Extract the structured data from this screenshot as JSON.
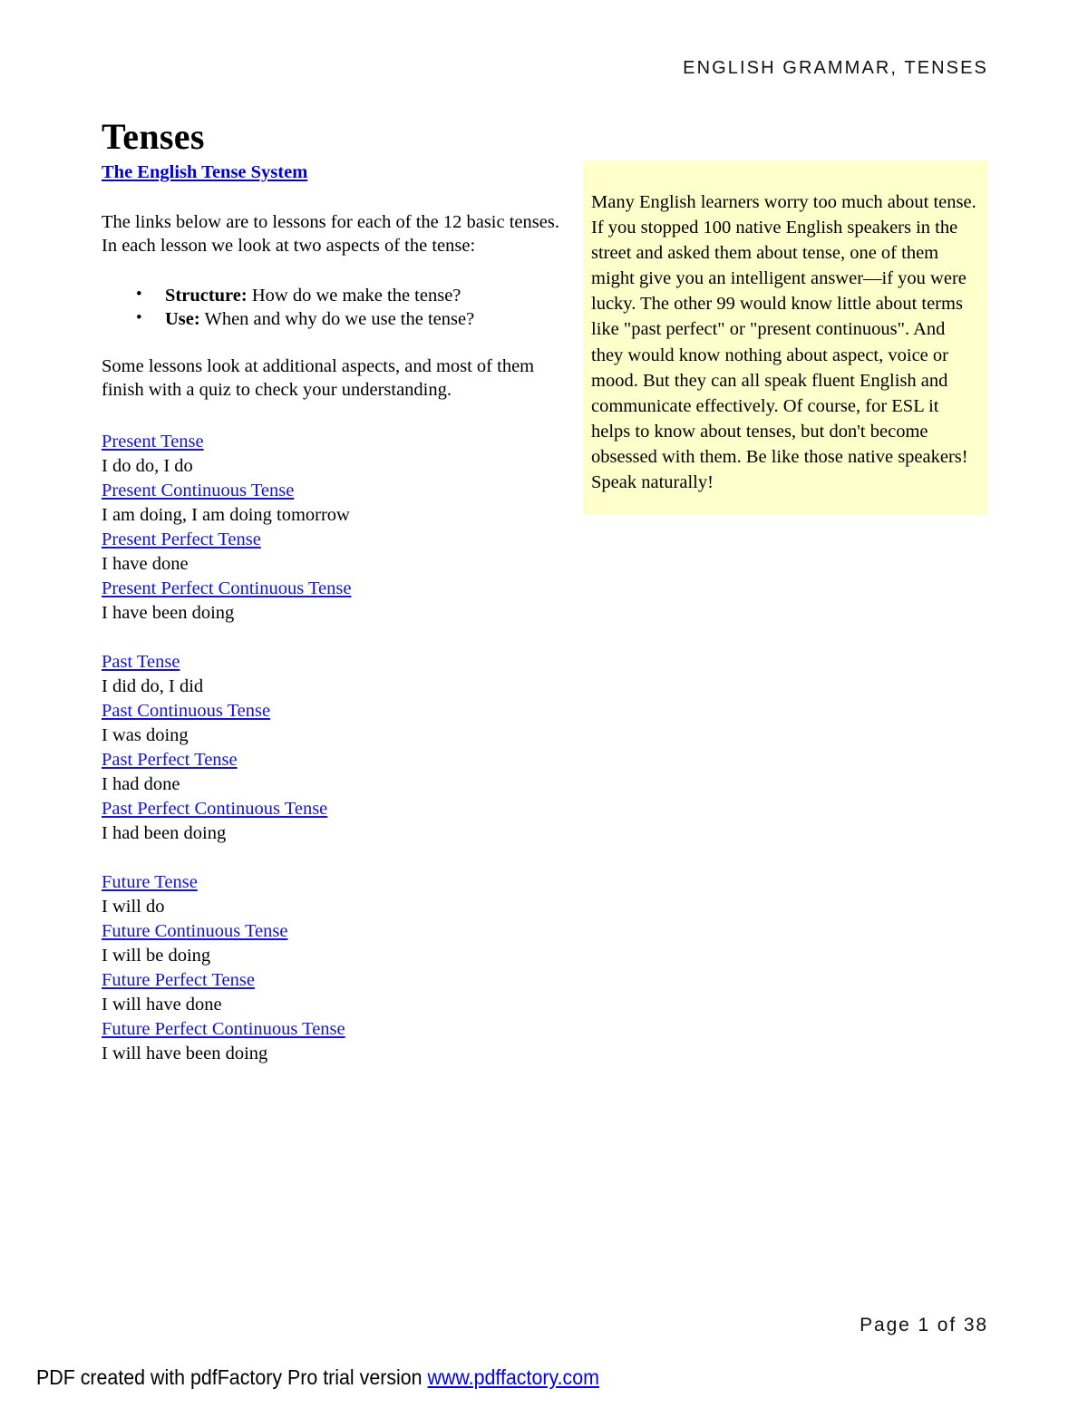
{
  "header": {
    "running_title": "ENGLISH GRAMMAR, TENSES"
  },
  "title": "Tenses",
  "left_column": {
    "section_link": "The English Tense System",
    "intro_paragraph": "The links below are to lessons for each of the 12 basic tenses. In each lesson we look at two aspects of the tense:",
    "aspects": [
      {
        "term": "Structure:",
        "description": " How do we make the tense?"
      },
      {
        "term": "Use:",
        "description": " When and why do we use the tense?"
      }
    ],
    "extra_paragraph": "Some lessons look at additional aspects, and most of them finish with a quiz to check your understanding.",
    "tense_groups": [
      {
        "name": "present",
        "entries": [
          {
            "link": "Present Tense",
            "example": "I do do, I do"
          },
          {
            "link": "Present Continuous Tense",
            "example": "I am doing, I am doing tomorrow"
          },
          {
            "link": "Present Perfect Tense",
            "example": "I have done"
          },
          {
            "link": "Present Perfect Continuous Tense",
            "example": "I have been doing"
          }
        ]
      },
      {
        "name": "past",
        "entries": [
          {
            "link": "Past Tense",
            "example": "I did do, I did"
          },
          {
            "link": "Past Continuous Tense",
            "example": "I was doing"
          },
          {
            "link": "Past Perfect Tense",
            "example": "I had done"
          },
          {
            "link": "Past Perfect Continuous Tense",
            "example": "I had been doing"
          }
        ]
      },
      {
        "name": "future",
        "entries": [
          {
            "link": "Future Tense",
            "example": "I will do"
          },
          {
            "link": "Future Continuous Tense",
            "example": "I will be doing"
          },
          {
            "link": "Future Perfect Tense",
            "example": "I will have done"
          },
          {
            "link": "Future Perfect Continuous Tense",
            "example": "I will have been doing"
          }
        ]
      }
    ]
  },
  "callout": {
    "background_color": "#ffffcc",
    "text": "Many English learners worry too much about tense. If you stopped 100 native English speakers in the street and asked them about tense, one of them might give you an intelligent answer—if you were lucky. The other 99 would know little about terms like \"past perfect\" or \"present continuous\". And they would know nothing about aspect, voice or mood. But they can all speak fluent English and communicate effectively. Of course, for ESL it helps to know about tenses, but don't become obsessed with them. Be like those native speakers! Speak naturally!"
  },
  "footer": {
    "page_number": "Page 1 of 38",
    "credit_text": "PDF created with pdfFactory Pro trial version ",
    "credit_link": "www.pdffactory.com"
  },
  "colors": {
    "link_blue": "#1414d2",
    "section_link_blue": "#0000d8",
    "callout_yellow": "#ffffcc",
    "text_black": "#000000"
  }
}
